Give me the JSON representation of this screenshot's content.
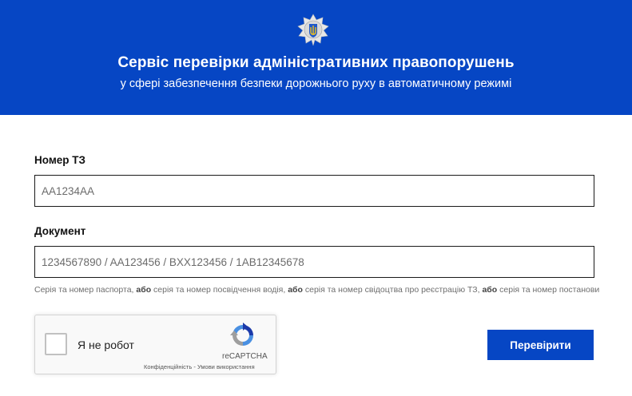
{
  "header": {
    "title": "Сервіс перевірки адміністративних правопорушень",
    "subtitle": "у сфері забезпечення безпеки дорожнього руху в автоматичному режимі",
    "background_color": "#0646c4",
    "emblem_icon": "police-emblem-icon"
  },
  "form": {
    "vehicle_number": {
      "label": "Номер ТЗ",
      "value": "",
      "placeholder": "AA1234AA"
    },
    "document": {
      "label": "Документ",
      "value": "",
      "placeholder": "1234567890 / AA123456 / BXX123456 / 1AB12345678"
    },
    "hint": {
      "part1": "Серія та номер паспорта, ",
      "or1": "або",
      "part2": " серія та номер посвідчення водія, ",
      "or2": "або",
      "part3": " серія та номер свідоцтва про реєстрацію ТЗ, ",
      "or3": "або",
      "part4": " серія та номер постанови"
    },
    "submit_label": "Перевірити"
  },
  "recaptcha": {
    "label": "Я не робот",
    "brand": "reCAPTCHA",
    "privacy": "Конфіденційність",
    "separator": " - ",
    "terms": "Умови використання",
    "checked": false
  }
}
